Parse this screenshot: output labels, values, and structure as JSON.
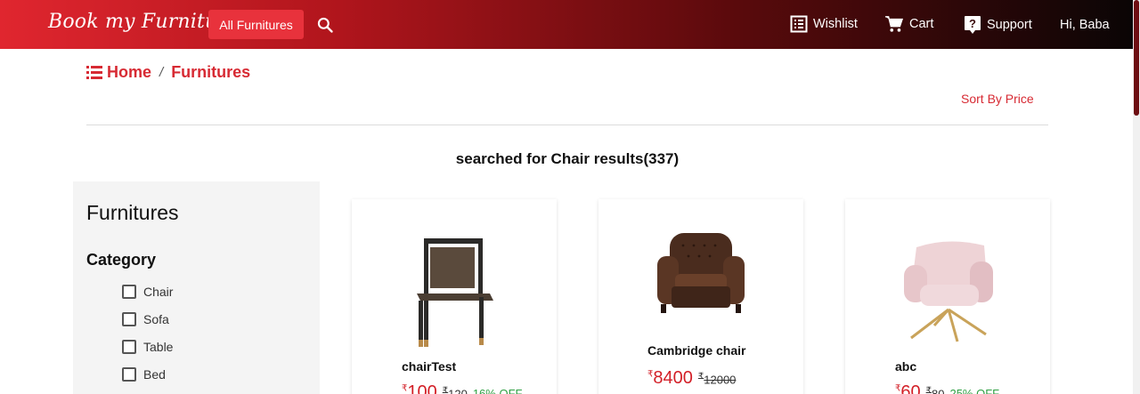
{
  "header": {
    "logo": "Book my Furniture",
    "all_button": "All Furnitures",
    "wishlist": "Wishlist",
    "cart": "Cart",
    "support": "Support",
    "user": "Hi, Baba"
  },
  "breadcrumb": {
    "home": "Home",
    "separator": "/",
    "current": "Furnitures"
  },
  "sort_label": "Sort By Price",
  "results_heading": "searched for Chair results(337)",
  "sidebar": {
    "title": "Furnitures",
    "category_title": "Category",
    "categories": [
      "Chair",
      "Sofa",
      "Table",
      "Bed"
    ]
  },
  "products": [
    {
      "name": "chairTest",
      "price": "100",
      "mrp": "120",
      "off": "16% OFF"
    },
    {
      "name": "Cambridge chair",
      "price": "8400",
      "mrp": "12000",
      "off": ""
    },
    {
      "name": "abc",
      "price": "60",
      "mrp": "80",
      "off": "25% OFF"
    }
  ],
  "colors": {
    "accent": "#d72a33",
    "price": "#d31f27",
    "discount": "#2ea043"
  }
}
